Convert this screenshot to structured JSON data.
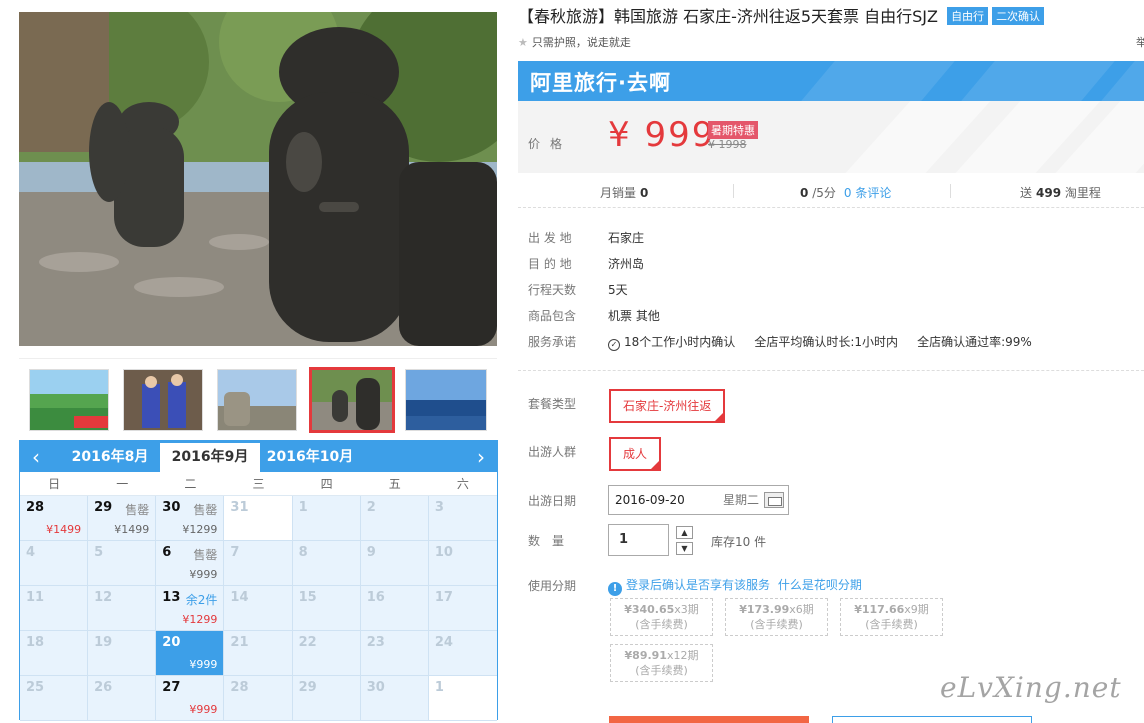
{
  "product": {
    "title": "【春秋旅游】韩国旅游 石家庄-济州往返5天套票 自由行SJZ",
    "badges": [
      "自由行",
      "二次确认"
    ],
    "subtitle": "只需护照，说走就走",
    "right_cut": "举"
  },
  "brand": {
    "name": "阿里旅行·去啊"
  },
  "price": {
    "label": "价格",
    "current": "¥ 999",
    "promo": "暑期特惠",
    "original": "¥ 1998"
  },
  "stats": {
    "monthly_sales_label": "月销量",
    "monthly_sales": "0",
    "rating": "0",
    "rating_suffix": "/5分",
    "reviews": "0 条评论",
    "points_prefix": "送",
    "points": "499",
    "points_suffix": "淘里程"
  },
  "info": [
    {
      "key": "出 发 地",
      "value": "石家庄"
    },
    {
      "key": "目 的 地",
      "value": "济州岛"
    },
    {
      "key": "行程天数",
      "value": "5天"
    },
    {
      "key": "商品包含",
      "value": "机票  其他"
    },
    {
      "key": "服务承诺",
      "value": "18个工作小时内确认     全店平均确认时长:1小时内     全店确认通过率:99%"
    }
  ],
  "options": {
    "package_label": "套餐类型",
    "package_value": "石家庄-济州往返",
    "group_label": "出游人群",
    "group_value": "成人",
    "date_label": "出游日期",
    "date_value": "2016-09-20",
    "date_weekday": "星期二",
    "qty_label": "数　量",
    "qty_value": "1",
    "stock": "库存10 件",
    "installment_label": "使用分期",
    "installment_info": "登录后确认是否享有该服务",
    "installment_link": "什么是花呗分期",
    "installments": [
      {
        "amount": "¥340.65",
        "period": "x3期",
        "fee": "(含手续费)"
      },
      {
        "amount": "¥173.99",
        "period": "x6期",
        "fee": "(含手续费)"
      },
      {
        "amount": "¥117.66",
        "period": "x9期",
        "fee": "(含手续费)"
      },
      {
        "amount": "¥89.91",
        "period": "x12期",
        "fee": "(含手续费)"
      }
    ]
  },
  "calendar": {
    "months": [
      "2016年8月",
      "2016年9月",
      "2016年10月"
    ],
    "weekdays": [
      "日",
      "一",
      "二",
      "三",
      "四",
      "五",
      "六"
    ],
    "cells": [
      {
        "d": "28",
        "price": "¥1499",
        "avail": true,
        "red": true
      },
      {
        "d": "29",
        "tag": "售罄",
        "price": "¥1499",
        "avail": true
      },
      {
        "d": "30",
        "tag": "售罄",
        "price": "¥1299",
        "avail": true
      },
      {
        "d": "31",
        "plain": true
      },
      {
        "d": "1"
      },
      {
        "d": "2"
      },
      {
        "d": "3"
      },
      {
        "d": "4"
      },
      {
        "d": "5"
      },
      {
        "d": "6",
        "tag": "售罄",
        "price": "¥999",
        "avail": true
      },
      {
        "d": "7"
      },
      {
        "d": "8"
      },
      {
        "d": "9"
      },
      {
        "d": "10"
      },
      {
        "d": "11"
      },
      {
        "d": "12"
      },
      {
        "d": "13",
        "tag": "余2件",
        "tagBlue": true,
        "price": "¥1299",
        "avail": true,
        "red": true
      },
      {
        "d": "14"
      },
      {
        "d": "15"
      },
      {
        "d": "16"
      },
      {
        "d": "17"
      },
      {
        "d": "18"
      },
      {
        "d": "19"
      },
      {
        "d": "20",
        "price": "¥999",
        "avail": true,
        "selected": true
      },
      {
        "d": "21"
      },
      {
        "d": "22"
      },
      {
        "d": "23"
      },
      {
        "d": "24"
      },
      {
        "d": "25"
      },
      {
        "d": "26"
      },
      {
        "d": "27",
        "price": "¥999",
        "avail": true,
        "red": true
      },
      {
        "d": "28"
      },
      {
        "d": "29"
      },
      {
        "d": "30"
      },
      {
        "d": "1",
        "plain": true
      }
    ]
  },
  "watermark": "eLvXing.net",
  "colors": {
    "accent": "#3d9fe8",
    "price": "#e4393c"
  }
}
